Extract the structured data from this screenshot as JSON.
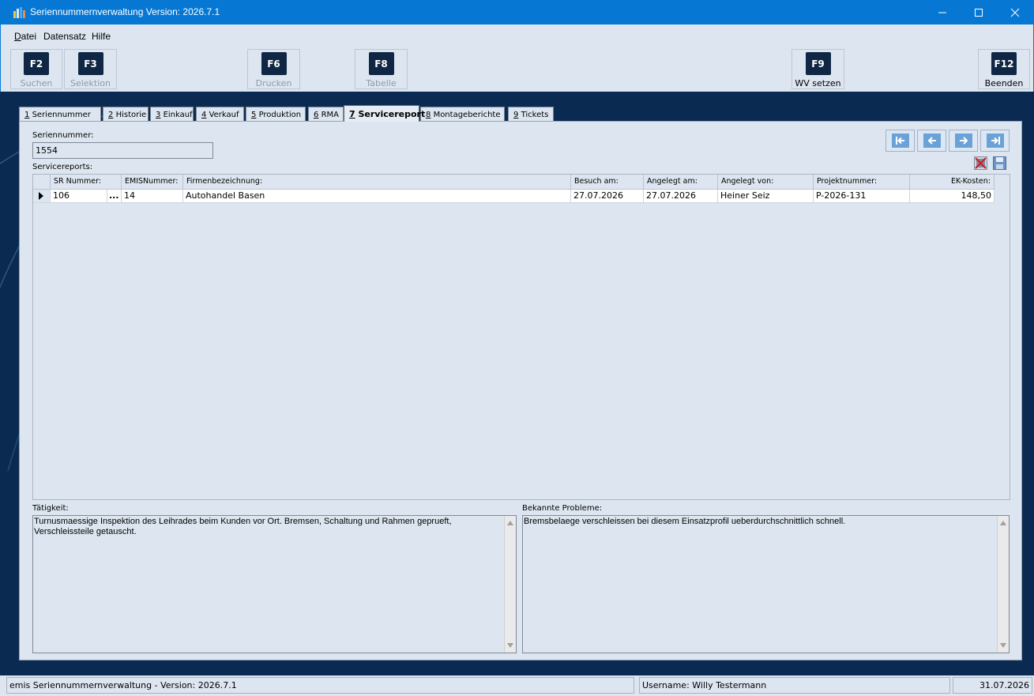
{
  "window": {
    "title": "Seriennummernverwaltung Version: 2026.7.1",
    "minimize_icon": "minimize-icon",
    "maximize_icon": "maximize-icon",
    "close_icon": "close-icon"
  },
  "menu": [
    {
      "label": "Datei",
      "accel": "D",
      "rest": "atei"
    },
    {
      "label": "Datensatz"
    },
    {
      "label": "Hilfe"
    }
  ],
  "toolbar": [
    {
      "key": "F2",
      "label": "Suchen",
      "enabled": false
    },
    {
      "key": "F3",
      "label": "Selektion",
      "enabled": false
    },
    {
      "key": "F6",
      "label": "Drucken",
      "enabled": false
    },
    {
      "key": "F8",
      "label": "Tabelle",
      "enabled": false
    },
    {
      "key": "F9",
      "label": "WV setzen",
      "enabled": true
    },
    {
      "key": "F12",
      "label": "Beenden",
      "enabled": true
    }
  ],
  "tabs": [
    {
      "num": "1",
      "label": "Seriennummer"
    },
    {
      "num": "2",
      "label": "Historie"
    },
    {
      "num": "3",
      "label": "Einkauf"
    },
    {
      "num": "4",
      "label": "Verkauf"
    },
    {
      "num": "5",
      "label": "Produktion"
    },
    {
      "num": "6",
      "label": "RMA"
    },
    {
      "num": "7",
      "label": "Servicereport",
      "active": true
    },
    {
      "num": "8",
      "label": "Montageberichte"
    },
    {
      "num": "9",
      "label": "Tickets"
    }
  ],
  "form": {
    "serial_label": "Seriennummer:",
    "serial_value": "1554",
    "reports_label": "Servicereports:"
  },
  "nav": {
    "first_icon": "first-record-icon",
    "prev_icon": "previous-record-icon",
    "next_icon": "next-record-icon",
    "last_icon": "last-record-icon",
    "delete_icon": "delete-record-icon",
    "save_icon": "save-icon"
  },
  "grid": {
    "columns": [
      "SR Nummer:",
      "EMISNummer:",
      "Firmenbezeichnung:",
      "Besuch am:",
      "Angelegt am:",
      "Angelegt von:",
      "Projektnummer:",
      "EK-Kosten:"
    ],
    "rows": [
      {
        "sr": "106",
        "ellipsis": "...",
        "emis": "14",
        "firma": "Autohandel Basen",
        "besuch": "27.07.2026",
        "angelegt_am": "27.07.2026",
        "angelegt_von": "Heiner Seiz",
        "projekt": "P-2026-131",
        "kosten": "148,50"
      }
    ]
  },
  "taetigkeit": {
    "label": "Tätigkeit:",
    "text": "Turnusmaessige Inspektion des Leihrades beim Kunden vor Ort. Bremsen, Schaltung und Rahmen geprueft, Verschleissteile getauscht."
  },
  "probleme": {
    "label": "Bekannte Probleme:",
    "text": "Bremsbelaege verschleissen bei diesem Einsatzprofil ueberdurchschnittlich schnell."
  },
  "status": {
    "app": "emis Seriennummernverwaltung - Version: 2026.7.1",
    "user": "Username: Willy Testermann",
    "date": "31.07.2026"
  },
  "colors": {
    "titlebar": "#0678d4",
    "background": "#0b2a52",
    "panel": "#dde6f0",
    "key": "#0f2744"
  }
}
